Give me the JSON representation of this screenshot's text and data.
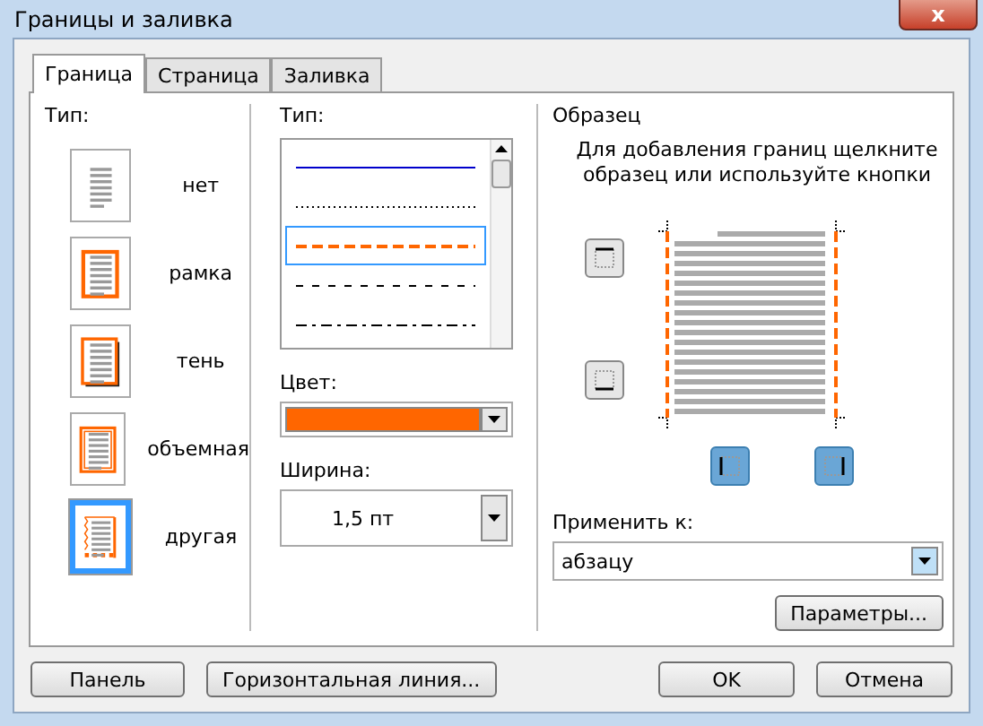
{
  "window": {
    "title": "Границы и заливка",
    "close": "x"
  },
  "tabs": [
    {
      "label": "Граница",
      "selected": true
    },
    {
      "label": "Страница",
      "selected": false
    },
    {
      "label": "Заливка",
      "selected": false
    }
  ],
  "setting": {
    "label": "Тип:",
    "items": [
      {
        "kind": "none",
        "label": "нет",
        "selected": false
      },
      {
        "kind": "box",
        "label": "рамка",
        "selected": false
      },
      {
        "kind": "shadow",
        "label": "тень",
        "selected": false
      },
      {
        "kind": "volume",
        "label": "объемная",
        "selected": false
      },
      {
        "kind": "custom",
        "label": "другая",
        "selected": true
      }
    ]
  },
  "style": {
    "label": "Тип:",
    "items": [
      {
        "kind": "solid",
        "selected": false
      },
      {
        "kind": "dotted",
        "selected": false
      },
      {
        "kind": "dashed",
        "selected": true
      },
      {
        "kind": "dashed-fine",
        "selected": false
      },
      {
        "kind": "dash-dot",
        "selected": false
      }
    ]
  },
  "color": {
    "label": "Цвет:",
    "color": "#ff6600"
  },
  "width": {
    "label": "Ширина:",
    "value": "1,5 пт"
  },
  "preview": {
    "title": "Образец",
    "hint": "Для добавления границ щелкните образец или используйте кнопки",
    "borders": [
      {
        "kind": "top",
        "on": false
      },
      {
        "kind": "bottom",
        "on": false
      },
      {
        "kind": "left",
        "on": true
      },
      {
        "kind": "right",
        "on": true
      }
    ]
  },
  "apply_to": {
    "label": "Применить к:",
    "value": "абзацу"
  },
  "options_button": "Параметры...",
  "buttons": [
    {
      "kind": "left",
      "label": "Панель"
    },
    {
      "kind": "left",
      "label": "Горизонтальная линия..."
    },
    {
      "kind": "right",
      "label": "OK"
    },
    {
      "kind": "right",
      "label": "Отмена"
    }
  ]
}
